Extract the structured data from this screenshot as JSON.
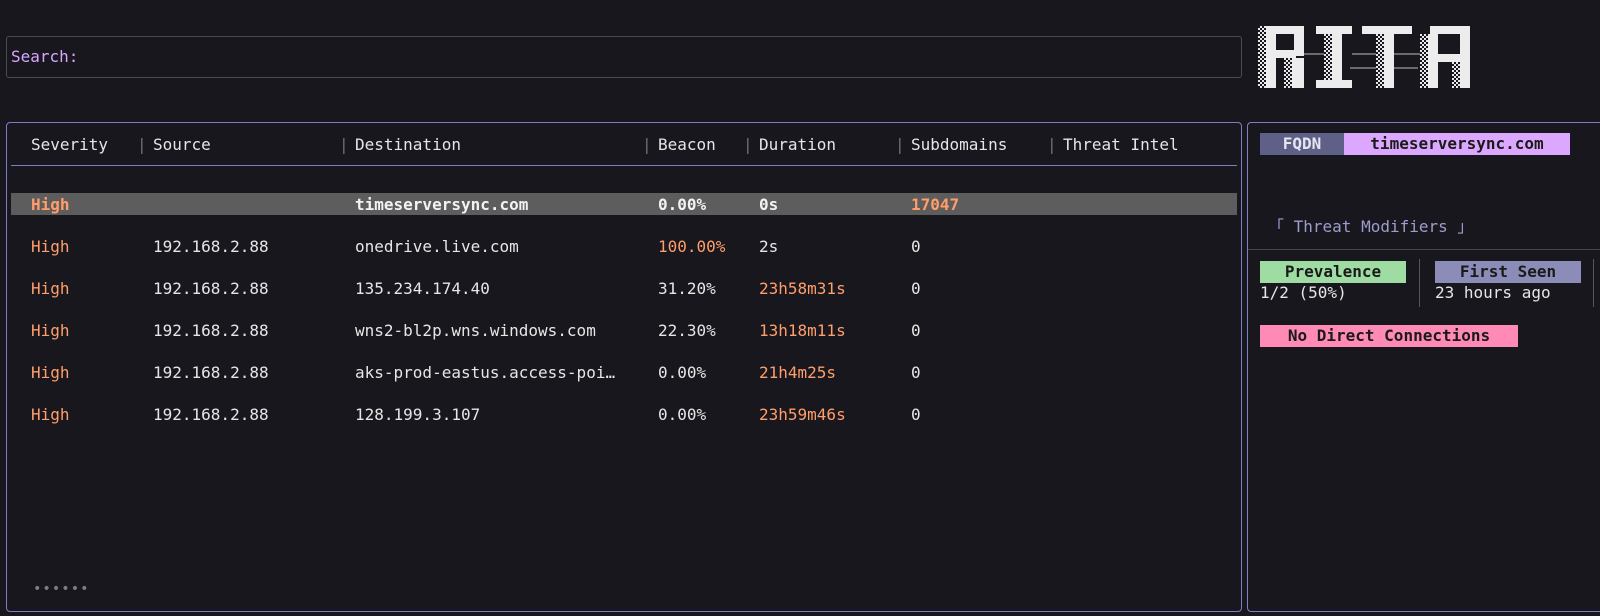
{
  "search": {
    "label": "Search:",
    "value": "",
    "placeholder": ""
  },
  "logo": {
    "text": "RITA"
  },
  "table": {
    "columns": [
      "Severity",
      "Source",
      "Destination",
      "Beacon",
      "Duration",
      "Subdomains",
      "Threat Intel"
    ],
    "rows": [
      {
        "severity": "High",
        "source": "",
        "destination": "timeserversync.com",
        "beacon": "0.00%",
        "duration": "0s",
        "subdomains": "17047",
        "threat_intel": ""
      },
      {
        "severity": "High",
        "source": "192.168.2.88",
        "destination": "onedrive.live.com",
        "beacon": "100.00%",
        "duration": "2s",
        "subdomains": "0",
        "threat_intel": ""
      },
      {
        "severity": "High",
        "source": "192.168.2.88",
        "destination": "135.234.174.40",
        "beacon": "31.20%",
        "duration": "23h58m31s",
        "subdomains": "0",
        "threat_intel": ""
      },
      {
        "severity": "High",
        "source": "192.168.2.88",
        "destination": "wns2-bl2p.wns.windows.com",
        "beacon": "22.30%",
        "duration": "13h18m11s",
        "subdomains": "0",
        "threat_intel": ""
      },
      {
        "severity": "High",
        "source": "192.168.2.88",
        "destination": "aks-prod-eastus.access-poi…",
        "beacon": "0.00%",
        "duration": "21h4m25s",
        "subdomains": "0",
        "threat_intel": ""
      },
      {
        "severity": "High",
        "source": "192.168.2.88",
        "destination": "128.199.3.107",
        "beacon": "0.00%",
        "duration": "23h59m46s",
        "subdomains": "0",
        "threat_intel": ""
      }
    ],
    "pager": "••••••"
  },
  "detail": {
    "fqdn_label": "FQDN",
    "fqdn_value": "timeserversync.com",
    "modifiers_title": "「 Threat Modifiers 」",
    "prevalence_label": "Prevalence",
    "prevalence_value": "1/2 (50%)",
    "first_seen_label": "First Seen",
    "first_seen_value": "23 hours ago",
    "no_direct_label": "No Direct Connections"
  },
  "colors": {
    "background": "#18171d",
    "border_accent": "#7d7fc4",
    "highlight_orange": "#ff9e6b",
    "search_label": "#d7a6ff",
    "fqdn_value_bg": "#dca8ff",
    "prevalence_bg": "#9fdca4",
    "first_seen_bg": "#8c8cb8",
    "no_direct_bg": "#ff8ab5",
    "selected_row_bg": "#5d5d5d"
  }
}
